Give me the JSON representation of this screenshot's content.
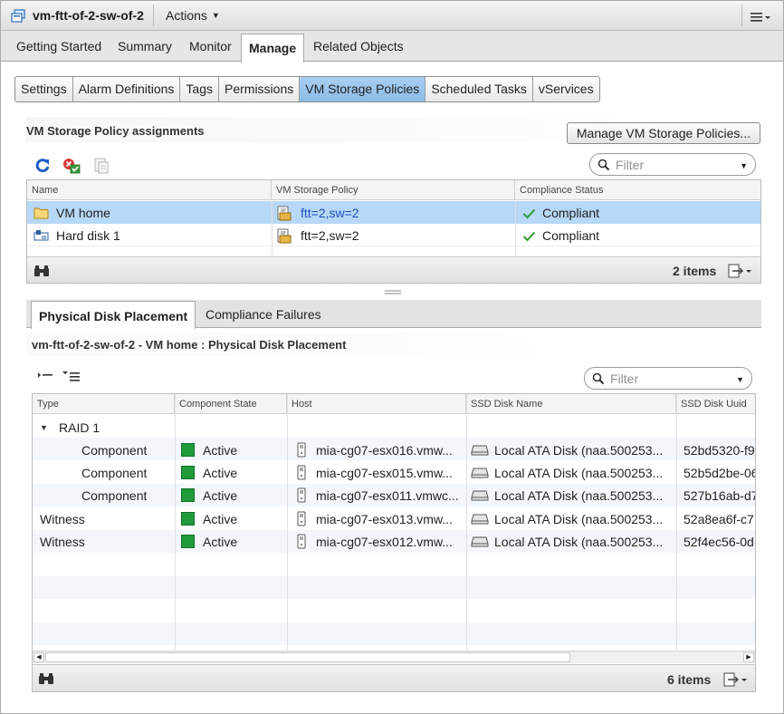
{
  "window": {
    "title": "vm-ftt-of-2-sw-of-2",
    "actions_label": "Actions"
  },
  "main_tabs": [
    {
      "label": "Getting Started"
    },
    {
      "label": "Summary"
    },
    {
      "label": "Monitor"
    },
    {
      "label": "Manage",
      "active": true
    },
    {
      "label": "Related Objects"
    }
  ],
  "sub_tabs": [
    {
      "label": "Settings"
    },
    {
      "label": "Alarm Definitions"
    },
    {
      "label": "Tags"
    },
    {
      "label": "Permissions"
    },
    {
      "label": "VM Storage Policies",
      "active": true
    },
    {
      "label": "Scheduled Tasks"
    },
    {
      "label": "vServices"
    }
  ],
  "assignments": {
    "title": "VM Storage Policy assignments",
    "manage_button": "Manage VM Storage Policies...",
    "filter_placeholder": "Filter",
    "columns": [
      "Name",
      "VM Storage Policy",
      "Compliance Status"
    ],
    "rows": [
      {
        "name": "VM home",
        "name_icon": "folder-icon",
        "policy": "ftt=2,sw=2",
        "status": "Compliant",
        "selected": true
      },
      {
        "name": "Hard disk 1",
        "name_icon": "hard-disk-icon",
        "policy": "ftt=2,sw=2",
        "status": "Compliant",
        "selected": false
      }
    ],
    "item_count": "2 items"
  },
  "placement": {
    "tabs": [
      {
        "label": "Physical Disk Placement",
        "active": true
      },
      {
        "label": "Compliance Failures"
      }
    ],
    "title": "vm-ftt-of-2-sw-of-2 - VM home : Physical Disk Placement",
    "filter_placeholder": "Filter",
    "columns": [
      "Type",
      "Component State",
      "Host",
      "SSD Disk Name",
      "SSD Disk Uuid"
    ],
    "rows": [
      {
        "type": "RAID 1",
        "level": 0,
        "expandable": true,
        "state": "",
        "host": "",
        "ssd_name": "",
        "ssd_uuid": ""
      },
      {
        "type": "Component",
        "level": 1,
        "state": "Active",
        "host": "mia-cg07-esx016.vmw...",
        "ssd_name": "Local ATA Disk (naa.500253...",
        "ssd_uuid": "52bd5320-f9"
      },
      {
        "type": "Component",
        "level": 1,
        "state": "Active",
        "host": "mia-cg07-esx015.vmw...",
        "ssd_name": "Local ATA Disk (naa.500253...",
        "ssd_uuid": "52b5d2be-06"
      },
      {
        "type": "Component",
        "level": 1,
        "state": "Active",
        "host": "mia-cg07-esx011.vmwc...",
        "ssd_name": "Local ATA Disk (naa.500253...",
        "ssd_uuid": "527b16ab-d7"
      },
      {
        "type": "Witness",
        "level": 0,
        "state": "Active",
        "host": "mia-cg07-esx013.vmw...",
        "ssd_name": "Local ATA Disk (naa.500253...",
        "ssd_uuid": "52a8ea6f-c7"
      },
      {
        "type": "Witness",
        "level": 0,
        "state": "Active",
        "host": "mia-cg07-esx012.vmw...",
        "ssd_name": "Local ATA Disk (naa.500253...",
        "ssd_uuid": "52f4ec56-0d"
      }
    ],
    "item_count": "6 items"
  },
  "colors": {
    "selected_row": "#b7d8f7",
    "active_state": "#1f9b3a",
    "compliant_check": "#2e9a2e",
    "link_blue": "#1a4fb8",
    "active_tab": "#9cc7ee"
  }
}
